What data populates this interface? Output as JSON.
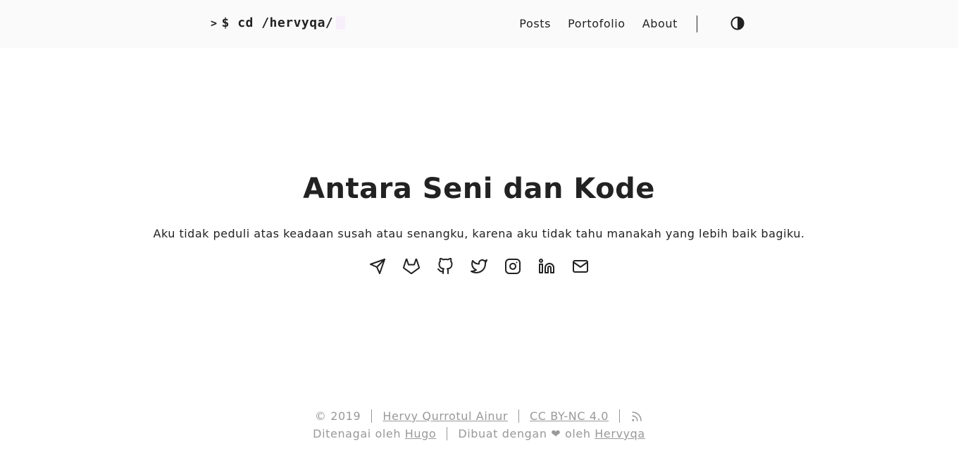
{
  "header": {
    "logo_prompt": ">",
    "logo_text": "$ cd /hervyqa/",
    "nav": [
      {
        "label": "Posts"
      },
      {
        "label": "Portofolio"
      },
      {
        "label": "About"
      }
    ],
    "theme_toggle_icon": "contrast-icon"
  },
  "hero": {
    "title": "Antara Seni dan Kode",
    "tagline": "Aku tidak peduli atas keadaan susah atau senangku, karena aku tidak tahu manakah yang lebih baik bagiku.",
    "social_icons": [
      "telegram-icon",
      "gitlab-icon",
      "github-icon",
      "twitter-icon",
      "instagram-icon",
      "linkedin-icon",
      "mail-icon"
    ]
  },
  "footer": {
    "copyright": "© 2019",
    "author_link": "Hervy Qurrotul Ainur",
    "license_link": "CC BY-NC 4.0",
    "rss_icon": "rss-icon",
    "powered_prefix": "Ditenagai oleh ",
    "powered_link": "Hugo",
    "made_prefix": "Dibuat dengan ❤ oleh ",
    "made_link": "Hervyqa"
  }
}
